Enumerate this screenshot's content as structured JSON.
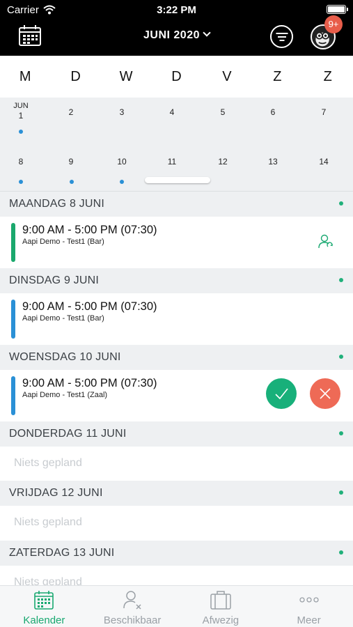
{
  "status_bar": {
    "carrier": "Carrier",
    "time": "3:22 PM"
  },
  "header": {
    "month_title": "JUNI 2020",
    "badge": "9+"
  },
  "weekdays": [
    "M",
    "D",
    "W",
    "D",
    "V",
    "Z",
    "Z"
  ],
  "grid": {
    "month_label": "JUN",
    "week1": [
      "1",
      "2",
      "3",
      "4",
      "5",
      "6",
      "7"
    ],
    "week2": [
      "8",
      "9",
      "10",
      "11",
      "12",
      "13",
      "14"
    ]
  },
  "days": [
    {
      "label": "MAANDAG 8 JUNI",
      "shift": {
        "time": "9:00 AM - 5:00 PM (07:30)",
        "detail": "Aapi Demo - Test1 (Bar)",
        "color": "#1aa86d"
      }
    },
    {
      "label": "DINSDAG 9 JUNI",
      "shift": {
        "time": "9:00 AM - 5:00 PM (07:30)",
        "detail": "Aapi Demo - Test1 (Bar)",
        "color": "#2a90d6"
      }
    },
    {
      "label": "WOENSDAG 10 JUNI",
      "shift": {
        "time": "9:00 AM - 5:00 PM (07:30)",
        "detail": "Aapi Demo - Test1 (Zaal)",
        "color": "#2a90d6"
      }
    },
    {
      "label": "DONDERDAG 11 JUNI",
      "empty": "Niets gepland"
    },
    {
      "label": "VRIJDAG 12 JUNI",
      "empty": "Niets gepland"
    },
    {
      "label": "ZATERDAG 13 JUNI",
      "empty": "Niets gepland"
    }
  ],
  "tabs": [
    {
      "label": "Kalender",
      "icon": "calendar-icon",
      "active": true
    },
    {
      "label": "Beschikbaar",
      "icon": "user-unavailable-icon",
      "active": false
    },
    {
      "label": "Afwezig",
      "icon": "suitcase-icon",
      "active": false
    },
    {
      "label": "Meer",
      "icon": "more-dots-icon",
      "active": false
    }
  ],
  "colors": {
    "accent_green": "#18a870",
    "blue": "#2a90d6",
    "reject_red": "#ee6a56"
  }
}
